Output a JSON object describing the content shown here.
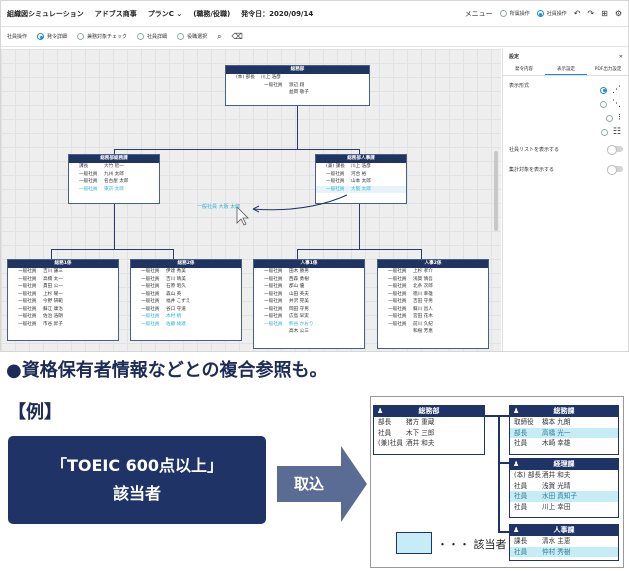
{
  "app": {
    "title": "組織図シミュレーション",
    "company": "アドブス商事",
    "menu_plan": "プランC",
    "menu_plan_caret": "⌄",
    "info": "(職務/役職)",
    "date": "発令日：2020/09/14",
    "menu": "メニュー",
    "radio_all": "所属操作",
    "radio_member": "社員操作"
  },
  "toolbar": {
    "label": "社員操作",
    "opts": [
      "発令詳細",
      "兼務対象チェック",
      "社員詳細",
      "役職選択"
    ]
  },
  "chart": {
    "root": {
      "title": "総務部",
      "rows": [
        [
          "(本) 部長",
          "川上 浩彦"
        ],
        [
          "一般社員",
          "渡辺 翔"
        ],
        [
          "",
          "益岡 敬子"
        ]
      ]
    },
    "div_a": {
      "title": "総務部総務課",
      "rows": [
        [
          "課長",
          "大竹 智一"
        ],
        [
          "一般社員",
          "九州 太郎"
        ],
        [
          "一般社員",
          "名古屋 太郎"
        ],
        [
          "一般社員",
          "東京 太郎"
        ]
      ]
    },
    "div_b": {
      "title": "総務部人事課",
      "rows": [
        [
          "(兼) 課長",
          "川上 浩彦"
        ],
        [
          "一般社員",
          "河合 裕"
        ],
        [
          "一般社員",
          "山本 太郎"
        ],
        [
          "一般社員",
          "大阪 太郎"
        ]
      ]
    },
    "floating": "一般社員 大阪 太郎",
    "teams": [
      {
        "title": "総務1係",
        "rows": [
          [
            "一般社員",
            "吉川 謙三"
          ],
          [
            "一般社員",
            "高橋 太一"
          ],
          [
            "一般社員",
            "貫田 公一"
          ],
          [
            "一般社員",
            "上杉 曜一"
          ],
          [
            "一般社員",
            "今野 研範"
          ],
          [
            "一般社員",
            "蘇江 康治"
          ],
          [
            "一般社員",
            "佐治 浩朗"
          ],
          [
            "一般社員",
            "市谷 昇子"
          ]
        ]
      },
      {
        "title": "総務2係",
        "rows": [
          [
            "一般社員",
            "伊達 秀美"
          ],
          [
            "一般社員",
            "吉川 晴美"
          ],
          [
            "一般社員",
            "石原 昭久"
          ],
          [
            "一般社員",
            "森山 英"
          ],
          [
            "一般社員",
            "福井 こずえ"
          ],
          [
            "一般社員",
            "谷口 守道"
          ],
          [
            "一般社員",
            "木村 梢"
          ],
          [
            "一般社員",
            "佐藤 綾達"
          ]
        ]
      },
      {
        "title": "人事1係",
        "rows": [
          [
            "一般社員",
            "田木 勝男"
          ],
          [
            "一般社員",
            "西森 勇樹"
          ],
          [
            "一般社員",
            "郡山 優"
          ],
          [
            "一般社員",
            "山田 英夫"
          ],
          [
            "一般社員",
            "井沢 晃美"
          ],
          [
            "一般社員",
            "岡田 守男"
          ],
          [
            "一般社員",
            "広島 早実"
          ],
          [
            "一般社員",
            "熊谷 かおり"
          ],
          [
            "",
            "高木 公三"
          ]
        ]
      },
      {
        "title": "人事2係",
        "rows": [
          [
            "一般社員",
            "上杉 孝介"
          ],
          [
            "一般社員",
            "浅賀 慎吾"
          ],
          [
            "一般社員",
            "北条 次郎"
          ],
          [
            "一般社員",
            "徳川 幸雄"
          ],
          [
            "一般社員",
            "吉田 守男"
          ],
          [
            "一般社員",
            "蘇川 昌人"
          ],
          [
            "一般社員",
            "宮田 花木"
          ],
          [
            "一般社員",
            "前川 久紀"
          ],
          [
            "",
            "和樹 芳恵"
          ]
        ]
      }
    ]
  },
  "panel": {
    "title": "設定",
    "close": "✕",
    "tabs": [
      "発令内容",
      "表示設定",
      "PDF出力設定"
    ],
    "display_label": "表示形式",
    "toggle1": "社員リストを表示する",
    "toggle2": "集計対象を表示する"
  },
  "promo": {
    "bullet": "●",
    "headline": "資格保有者情報などとの複合参照も。",
    "example": "【例】",
    "criteria_line1": "「TOEIC 600点以上」",
    "criteria_line2": "該当者",
    "arrow_label": "取込",
    "legend": "・・・ 該当者"
  },
  "example": {
    "soumu": {
      "title": "総務部",
      "rows": [
        [
          "部長",
          "猪方 重蔵",
          false
        ],
        [
          "社員",
          "木下 三郎",
          false
        ],
        [
          "(兼)社員",
          "酒井 和夫",
          false
        ]
      ]
    },
    "kanri": {
      "title": "総務課",
      "rows": [
        [
          "取締役",
          "橋本 九朗",
          false
        ],
        [
          "部長",
          "高橋 光一",
          true
        ],
        [
          "社員",
          "木崎 幸雄",
          false
        ]
      ]
    },
    "keiri": {
      "title": "経理課",
      "rows": [
        [
          "(本) 部長",
          "酒井 和夫",
          false
        ],
        [
          "社員",
          "浅賀 光晴",
          false
        ],
        [
          "社員",
          "水田 真知子",
          true
        ],
        [
          "社員",
          "川上 幸田",
          false
        ]
      ]
    },
    "jinji": {
      "title": "人事課",
      "rows": [
        [
          "課長",
          "清水 主恵",
          false
        ],
        [
          "社員",
          "仲村 秀樹",
          true
        ]
      ]
    }
  },
  "colors": {
    "navy": "#1f3366",
    "highlight": "#c6ecf5",
    "accent": "#1b8fd0"
  }
}
